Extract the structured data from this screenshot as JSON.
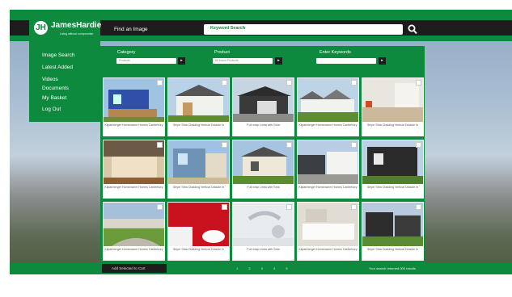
{
  "brand": {
    "name": "JamesHardie",
    "tagline": "Living without compromise"
  },
  "header": {
    "find_label": "Find an Image",
    "search_placeholder": "Keyword Search"
  },
  "menu": [
    "Image Search",
    "Latest Added",
    "Videos",
    "Documents",
    "My Basket",
    "Log Out"
  ],
  "filters": {
    "category_label": "Category",
    "category_value": "Products",
    "product_label": "Product",
    "product_value": "All brand Products",
    "keywords_label": "Enter Keywords",
    "keywords_value": ""
  },
  "tiles": [
    {
      "caption": "Kilpatrberger Homeowner Homes Canterbury",
      "theme": "blue-house"
    },
    {
      "caption": "Stryer Stria Cladding Vertical Outside In",
      "theme": "white-house"
    },
    {
      "caption": "Full wrap Linea with Stria",
      "theme": "dark-garage"
    },
    {
      "caption": "Kilpatrberger Homeowner Homes Canterbury",
      "theme": "row-houses"
    },
    {
      "caption": "Stryer Stria Cladding Vertical Outside In",
      "theme": "interior-white"
    },
    {
      "caption": "Kilpatrberger Homeowner Homes Canterbury",
      "theme": "interior-wood"
    },
    {
      "caption": "Stryer Stria Cladding Vertical Outside In",
      "theme": "blue-sky-house"
    },
    {
      "caption": "Full wrap Linea with Stria",
      "theme": "cream-house"
    },
    {
      "caption": "Kilpatrberger Homeowner Homes Canterbury",
      "theme": "street-houses"
    },
    {
      "caption": "Stryer Stria Cladding Vertical Outside In",
      "theme": "dark-house"
    },
    {
      "caption": "Kilpatrberger Homeowner Homes Canterbury",
      "theme": "green-street"
    },
    {
      "caption": "Stryer Stria Cladding Vertical Outside In",
      "theme": "red-bathroom"
    },
    {
      "caption": "Full wrap Linea with Stria",
      "theme": "tap"
    },
    {
      "caption": "Kilpatrberger Homeowner Homes Canterbury",
      "theme": "bathtub"
    },
    {
      "caption": "Stryer Stria Cladding Vertical Outside In",
      "theme": "dark-street"
    }
  ],
  "footer": {
    "add_to_cart": "Add Selected to Cart",
    "results": "Your search returned 000 results",
    "pager": "1 2 3 4 5"
  },
  "colors": {
    "brand_green": "#0e8a3e",
    "bar_dark": "#1d1d1d"
  }
}
